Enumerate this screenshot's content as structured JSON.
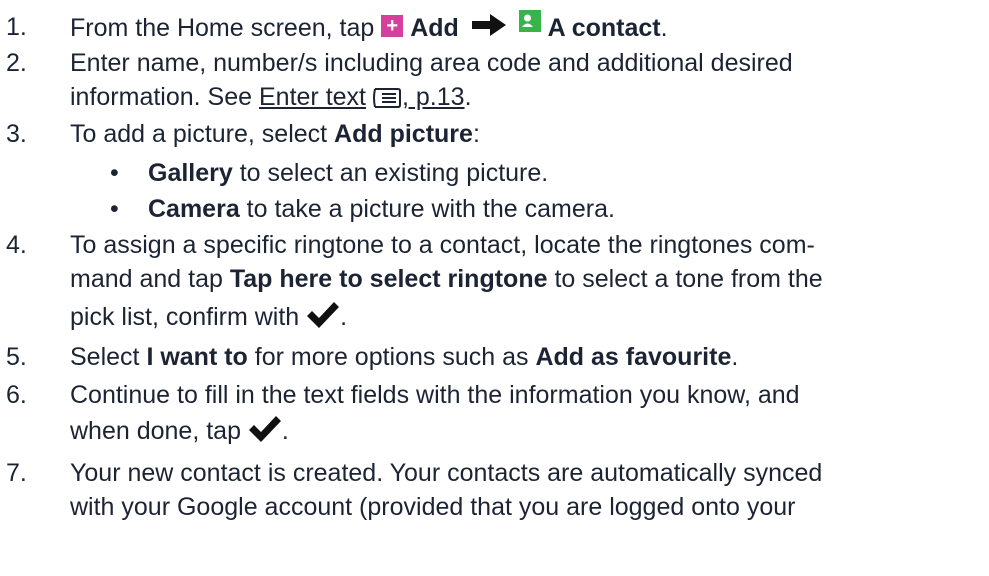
{
  "steps": [
    {
      "num": "1.",
      "pre": "From the Home screen, tap ",
      "add": "Add",
      "contact": "A contact",
      "end": "."
    },
    {
      "num": "2.",
      "l1": "Enter name, number/s including area code and additional desired",
      "l2_pre": "information. See ",
      "link": "Enter text",
      "link2": ", p.13",
      "l2_end": "."
    },
    {
      "num": "3.",
      "pre": "To add a picture, select ",
      "bold": "Add picture",
      "end": ":"
    },
    {
      "num": "4.",
      "l1": "To assign a specific ringtone to a contact, locate the ringtones com-",
      "l2_pre": "mand and tap ",
      "bold": "Tap here to select ringtone",
      "l2_end": " to select a tone from the",
      "l3": "pick list, confirm with ",
      "l3_end": "."
    },
    {
      "num": "5.",
      "pre": "Select ",
      "bold1": "I want to",
      "mid": " for more options such as ",
      "bold2": "Add as favourite",
      "end": "."
    },
    {
      "num": "6.",
      "l1": "Continue to fill in the text fields with the information you know, and",
      "l2": "when done, tap ",
      "l2_end": "."
    },
    {
      "num": "7.",
      "l1": "Your new contact is created. Your contacts are automatically synced",
      "l2": "with your Google account (provided that you are logged onto your"
    }
  ],
  "bullets": [
    {
      "bold": "Gallery",
      "rest": " to select an existing picture."
    },
    {
      "bold": "Camera",
      "rest": " to take a picture with the camera."
    }
  ],
  "icons": {
    "add": "plus-square-icon",
    "arrow": "arrow-right-icon",
    "contact": "contact-card-icon",
    "keyboard": "keyboard-icon",
    "check": "checkmark-icon"
  },
  "colors": {
    "text": "#1c2434",
    "add_icon": "#d6409d",
    "contact_icon": "#37b44a"
  }
}
